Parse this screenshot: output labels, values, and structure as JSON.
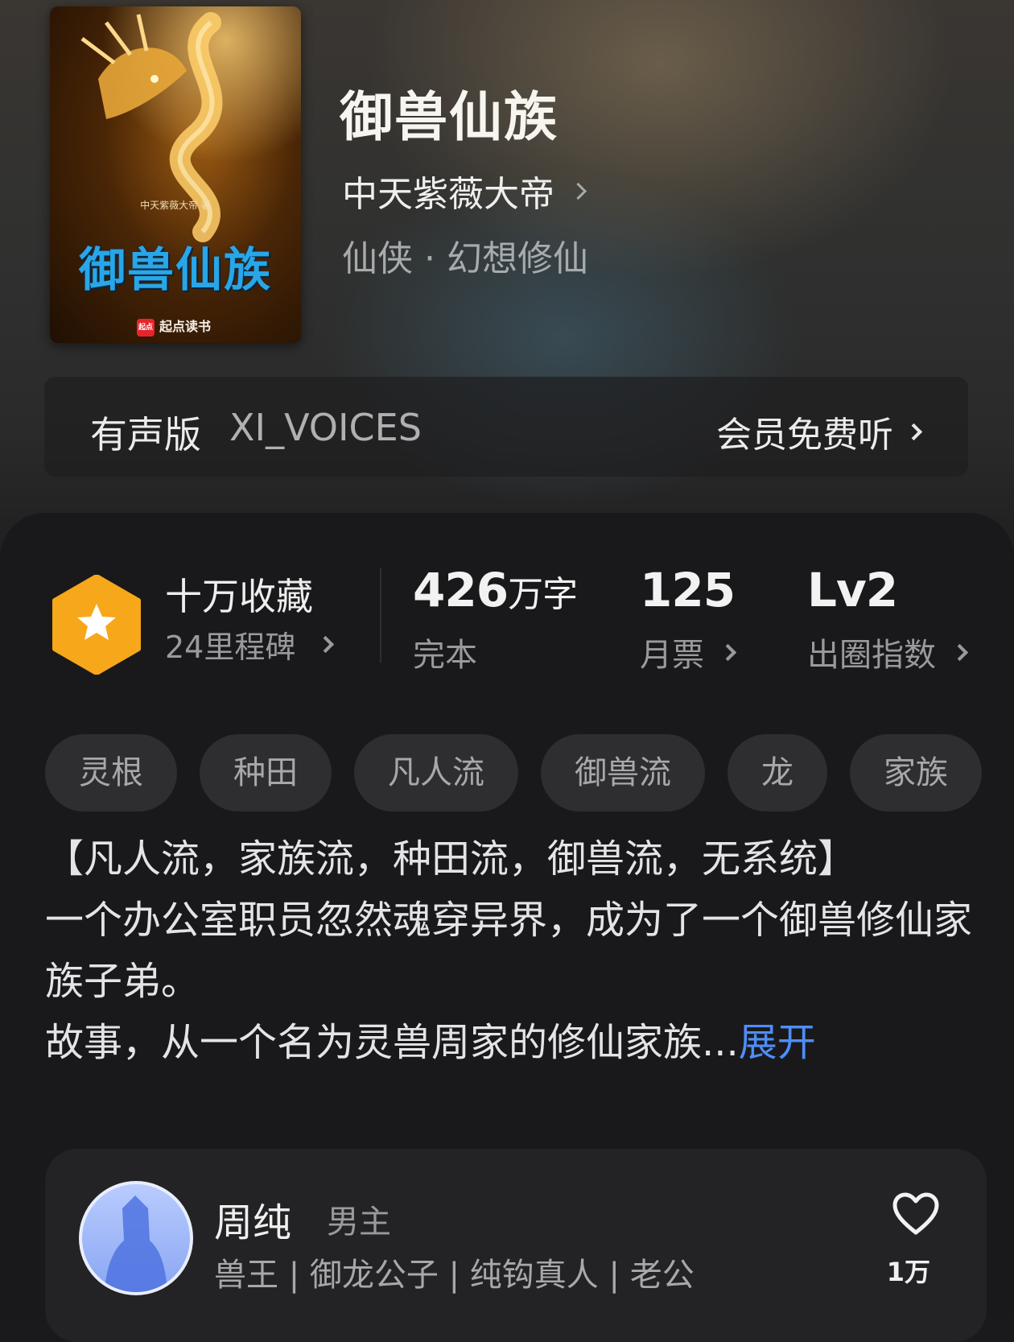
{
  "book": {
    "title": "御兽仙族",
    "author": "中天紫薇大帝",
    "genre": "仙侠 · 幻想修仙",
    "cover": {
      "title": "御兽仙族",
      "author_line": "中天紫薇大帝 著",
      "publisher": "起点读书",
      "publisher_logo": "起点"
    }
  },
  "audio": {
    "label": "有声版",
    "voice": "XI_VOICES",
    "cta": "会员免费听"
  },
  "stats": {
    "favorites": {
      "title": "十万收藏",
      "sub": "24里程碑"
    },
    "words": {
      "value": "426",
      "unit": "万字",
      "sub": "完本"
    },
    "monthly_votes": {
      "value": "125",
      "sub": "月票"
    },
    "popularity": {
      "value": "Lv2",
      "sub": "出圈指数"
    }
  },
  "tags": [
    "灵根",
    "种田",
    "凡人流",
    "御兽流",
    "龙",
    "家族"
  ],
  "description": {
    "line1": "【凡人流，家族流，种田流，御兽流，无系统】",
    "line2": "一个办公室职员忽然魂穿异界，成为了一个御兽修仙家族子弟。",
    "line3": "故事，从一个名为灵兽周家的修仙家族...",
    "expand": "展开"
  },
  "character": {
    "name": "周纯",
    "role": "男主",
    "titles": "兽王 | 御龙公子 | 纯钩真人 | 老公",
    "likes": "1万"
  },
  "colors": {
    "accent_blue": "#4d8ef7",
    "badge_orange": "#f6a71a",
    "panel_bg": "#19191b"
  },
  "icons": [
    "chevron-right-icon",
    "star-hexagon-icon",
    "heart-icon"
  ]
}
